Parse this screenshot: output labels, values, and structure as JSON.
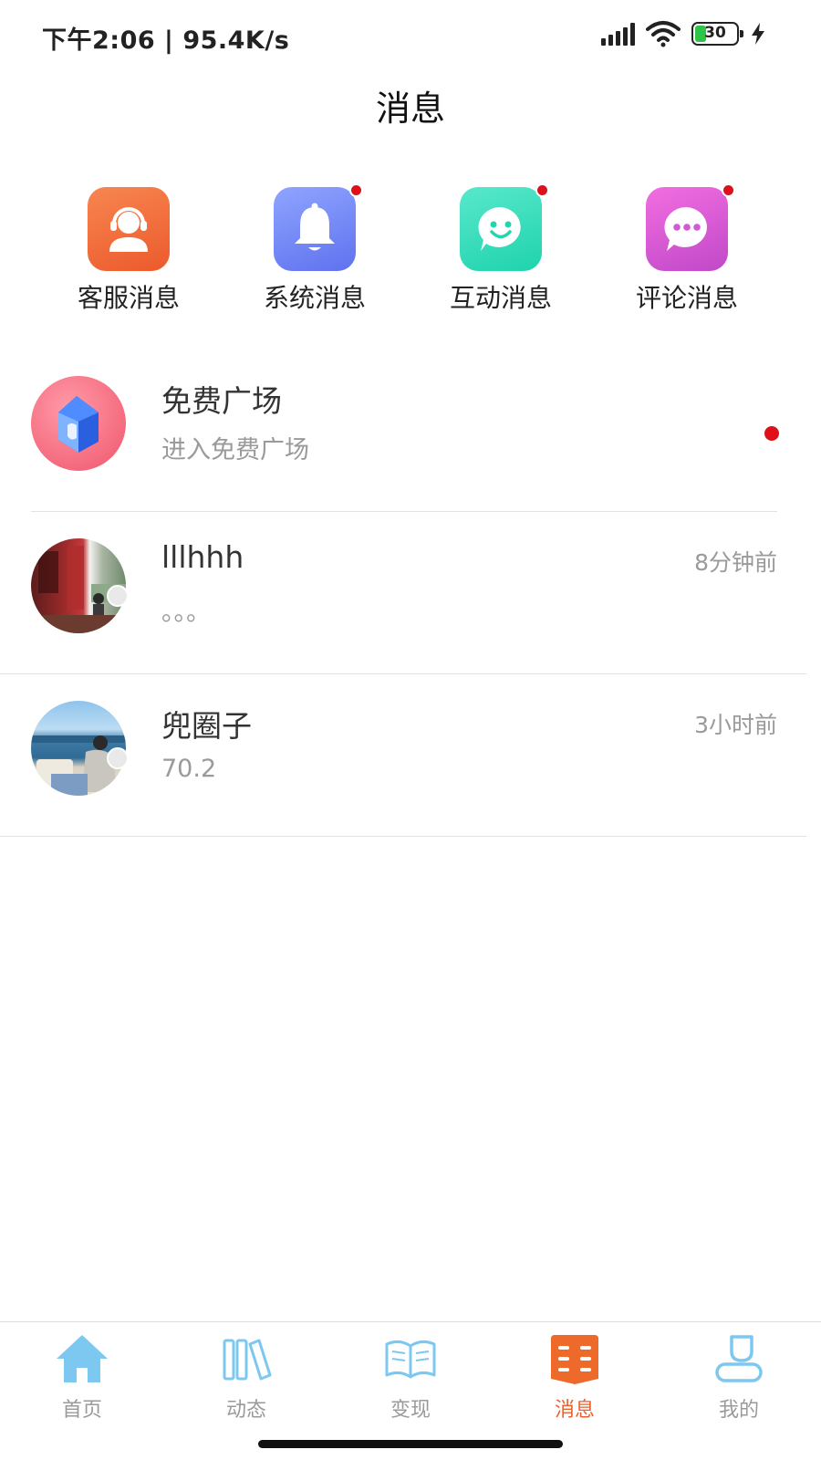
{
  "status_bar": {
    "time_speed": "下午2:06 | 95.4K/s",
    "battery_level": "30",
    "icons": [
      "signal-icon",
      "wifi-icon",
      "battery-icon",
      "charging-icon"
    ]
  },
  "header": {
    "title": "消息"
  },
  "categories": [
    {
      "label": "客服消息",
      "icon": "headset-agent-icon",
      "color": "#f26a3a",
      "unread": false
    },
    {
      "label": "系统消息",
      "icon": "bell-icon",
      "color": "#6f84f7",
      "unread": true
    },
    {
      "label": "互动消息",
      "icon": "smile-chat-icon",
      "color": "#2fdcb8",
      "unread": true
    },
    {
      "label": "评论消息",
      "icon": "comment-dots-icon",
      "color": "#d45ad9",
      "unread": true
    }
  ],
  "messages": [
    {
      "name": "免费广场",
      "preview": "进入免费广场",
      "time": "",
      "unread": true,
      "avatar": "house-logo"
    },
    {
      "name": "lllhhh",
      "preview": "。。。",
      "time": "8分钟前",
      "unread": false,
      "avatar": "user-photo"
    },
    {
      "name": "兜圈子",
      "preview": "70.2",
      "time": "3小时前",
      "unread": false,
      "avatar": "user-photo"
    }
  ],
  "tabbar": {
    "items": [
      {
        "label": "首页",
        "icon": "home-icon",
        "active": false
      },
      {
        "label": "动态",
        "icon": "books-icon",
        "active": false
      },
      {
        "label": "变现",
        "icon": "open-book-icon",
        "active": false
      },
      {
        "label": "消息",
        "icon": "message-list-icon",
        "active": true
      },
      {
        "label": "我的",
        "icon": "profile-icon",
        "active": false
      }
    ]
  },
  "colors": {
    "accent": "#e8622e",
    "unread_dot": "#e0101a",
    "tab_inactive_icon": "#7cc8f0"
  }
}
